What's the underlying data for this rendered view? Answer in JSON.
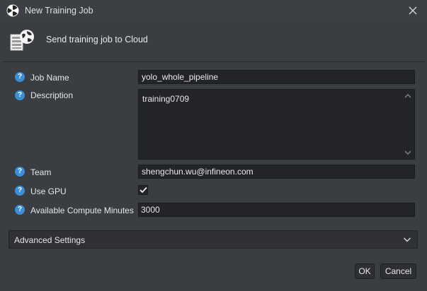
{
  "window": {
    "title": "New Training Job",
    "app_icon": "app-logo-icon",
    "close_icon": "close-icon"
  },
  "header": {
    "text": "Send training job to Cloud",
    "icon": "server-globe-icon"
  },
  "form": {
    "job_name": {
      "label": "Job Name",
      "value": "yolo_whole_pipeline"
    },
    "description": {
      "label": "Description",
      "value": "training0709"
    },
    "team": {
      "label": "Team",
      "value": "shengchun.wu@infineon.com"
    },
    "use_gpu": {
      "label": "Use GPU",
      "checked": true
    },
    "compute_minutes": {
      "label": "Available Compute Minutes",
      "value": "3000"
    },
    "help_glyph": "?"
  },
  "advanced": {
    "label": "Advanced Settings"
  },
  "buttons": {
    "ok": "OK",
    "cancel": "Cancel"
  },
  "colors": {
    "background": "#3a3d42",
    "field": "#232427",
    "help": "#3b8fd6"
  }
}
